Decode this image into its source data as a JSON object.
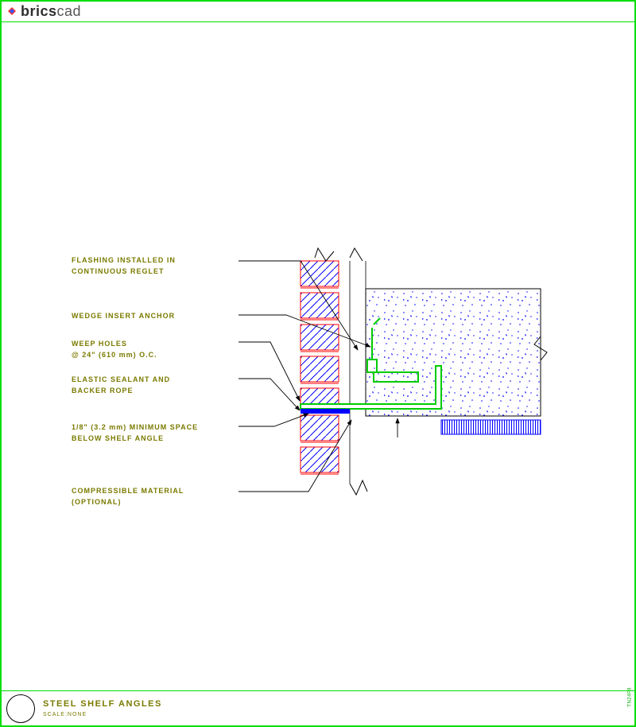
{
  "brand": {
    "first": "brics",
    "second": "cad"
  },
  "labels": {
    "flashing": "FLASHING INSTALLED IN",
    "flashing2": "CONTINUOUS REGLET",
    "wedge": "WEDGE INSERT ANCHOR",
    "weep": "WEEP HOLES",
    "weep2": "@ 24\" (610 mm) O.C.",
    "sealant": "ELASTIC SEALANT AND",
    "sealant2": "BACKER ROPE",
    "space": "1/8\" (3.2 mm) MINIMUM SPACE",
    "space2": "BELOW SHELF ANGLE",
    "compress": "COMPRESSIBLE MATERIAL",
    "compress2": "(OPTIONAL)"
  },
  "title": {
    "main": "STEEL SHELF ANGLES",
    "scale": "SCALE:NONE"
  },
  "side_tag": "TN24F8",
  "colors": {
    "frame": "#00dd00",
    "olive": "#7a7a00",
    "red": "#ff0000",
    "blue": "#0000ff",
    "green": "#00cc00"
  }
}
